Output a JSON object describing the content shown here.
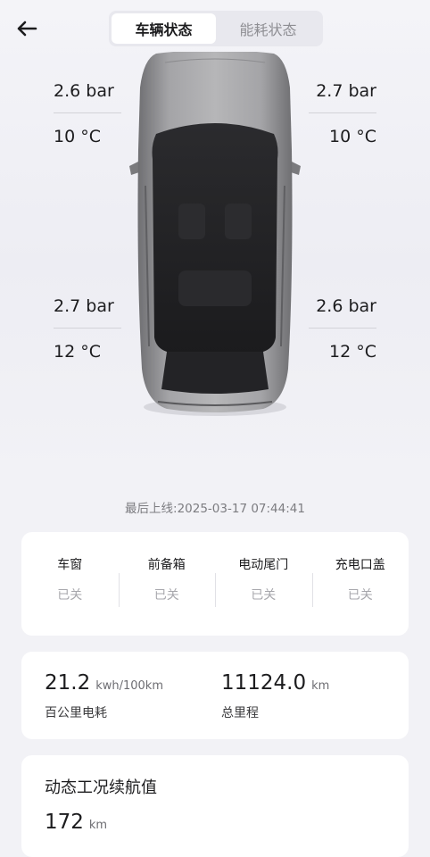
{
  "header": {
    "tabs": [
      {
        "label": "车辆状态",
        "active": true
      },
      {
        "label": "能耗状态",
        "active": false
      }
    ]
  },
  "tires": {
    "front_left": {
      "pressure": "2.6 bar",
      "temp": "10 °C"
    },
    "front_right": {
      "pressure": "2.7 bar",
      "temp": "10 °C"
    },
    "rear_left": {
      "pressure": "2.7 bar",
      "temp": "12 °C"
    },
    "rear_right": {
      "pressure": "2.6 bar",
      "temp": "12 °C"
    }
  },
  "last_online": "最后上线:2025-03-17 07:44:41",
  "status": [
    {
      "label": "车窗",
      "value": "已关"
    },
    {
      "label": "前备箱",
      "value": "已关"
    },
    {
      "label": "电动尾门",
      "value": "已关"
    },
    {
      "label": "充电口盖",
      "value": "已关"
    }
  ],
  "energy": {
    "consumption": {
      "value": "21.2",
      "unit": "kwh/100km",
      "caption": "百公里电耗"
    },
    "odometer": {
      "value": "11124.0",
      "unit": "km",
      "caption": "总里程"
    }
  },
  "range": {
    "title": "动态工况续航值",
    "value": "172",
    "unit": "km"
  },
  "colors": {
    "background": "#f2f2f6",
    "card": "#ffffff",
    "car_body": "#8d8d8f",
    "glass": "#1f1f22"
  }
}
